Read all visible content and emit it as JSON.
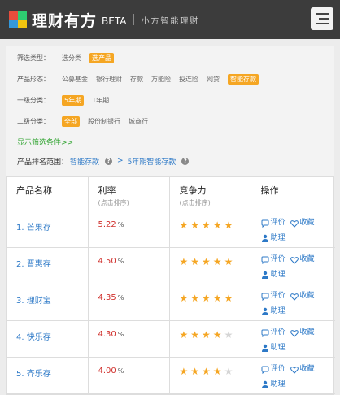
{
  "header": {
    "brand": "理财有方",
    "beta": "BETA",
    "slogan": "小方智能理财",
    "logo_colors": [
      "#e74c3c",
      "#2ecc71",
      "#3498db",
      "#f1c40f"
    ]
  },
  "filter": {
    "rows": [
      {
        "label": "筛选类型：",
        "options": [
          {
            "text": "选分类",
            "selected": false
          },
          {
            "text": "选产品",
            "selected": true
          }
        ]
      },
      {
        "label": "产品形态：",
        "options": [
          {
            "text": "公募基金",
            "selected": false
          },
          {
            "text": "银行理财",
            "selected": false
          },
          {
            "text": "存款",
            "selected": false
          },
          {
            "text": "万能险",
            "selected": false
          },
          {
            "text": "投连险",
            "selected": false
          },
          {
            "text": "网贷",
            "selected": false
          },
          {
            "text": "智能存款",
            "selected": true
          }
        ]
      },
      {
        "label": "一级分类：",
        "options": [
          {
            "text": "5年期",
            "selected": true
          },
          {
            "text": "1年期",
            "selected": false
          }
        ]
      },
      {
        "label": "二级分类：",
        "options": [
          {
            "text": "全部",
            "selected": true
          },
          {
            "text": "股份制银行",
            "selected": false
          },
          {
            "text": "城商行",
            "selected": false
          }
        ]
      }
    ],
    "more_link": "显示筛选条件>>",
    "rank_label": "产品排名范围：",
    "rank_level1": "智能存款",
    "rank_level2": "5年期智能存款",
    "question_mark": "?",
    "arrow": ">"
  },
  "table": {
    "headers": [
      {
        "title": "产品名称",
        "sub": ""
      },
      {
        "title": "利率",
        "sub": "(点击排序)"
      },
      {
        "title": "竞争力",
        "sub": "(点击排序)"
      },
      {
        "title": "操作",
        "sub": ""
      }
    ],
    "rows": [
      {
        "name": "1. 芒果存",
        "rate": "5.22",
        "unit": "%",
        "stars": 5
      },
      {
        "name": "2. 晋惠存",
        "rate": "4.50",
        "unit": "%",
        "stars": 5
      },
      {
        "name": "3. 理财宝",
        "rate": "4.35",
        "unit": "%",
        "stars": 5
      },
      {
        "name": "4. 快乐存",
        "rate": "4.30",
        "unit": "%",
        "stars": 4
      },
      {
        "name": "5. 齐乐存",
        "rate": "4.00",
        "unit": "%",
        "stars": 4
      }
    ],
    "ops": {
      "comment": "评价",
      "favorite": "收藏",
      "assistant": "助理"
    },
    "max_stars": 5
  }
}
